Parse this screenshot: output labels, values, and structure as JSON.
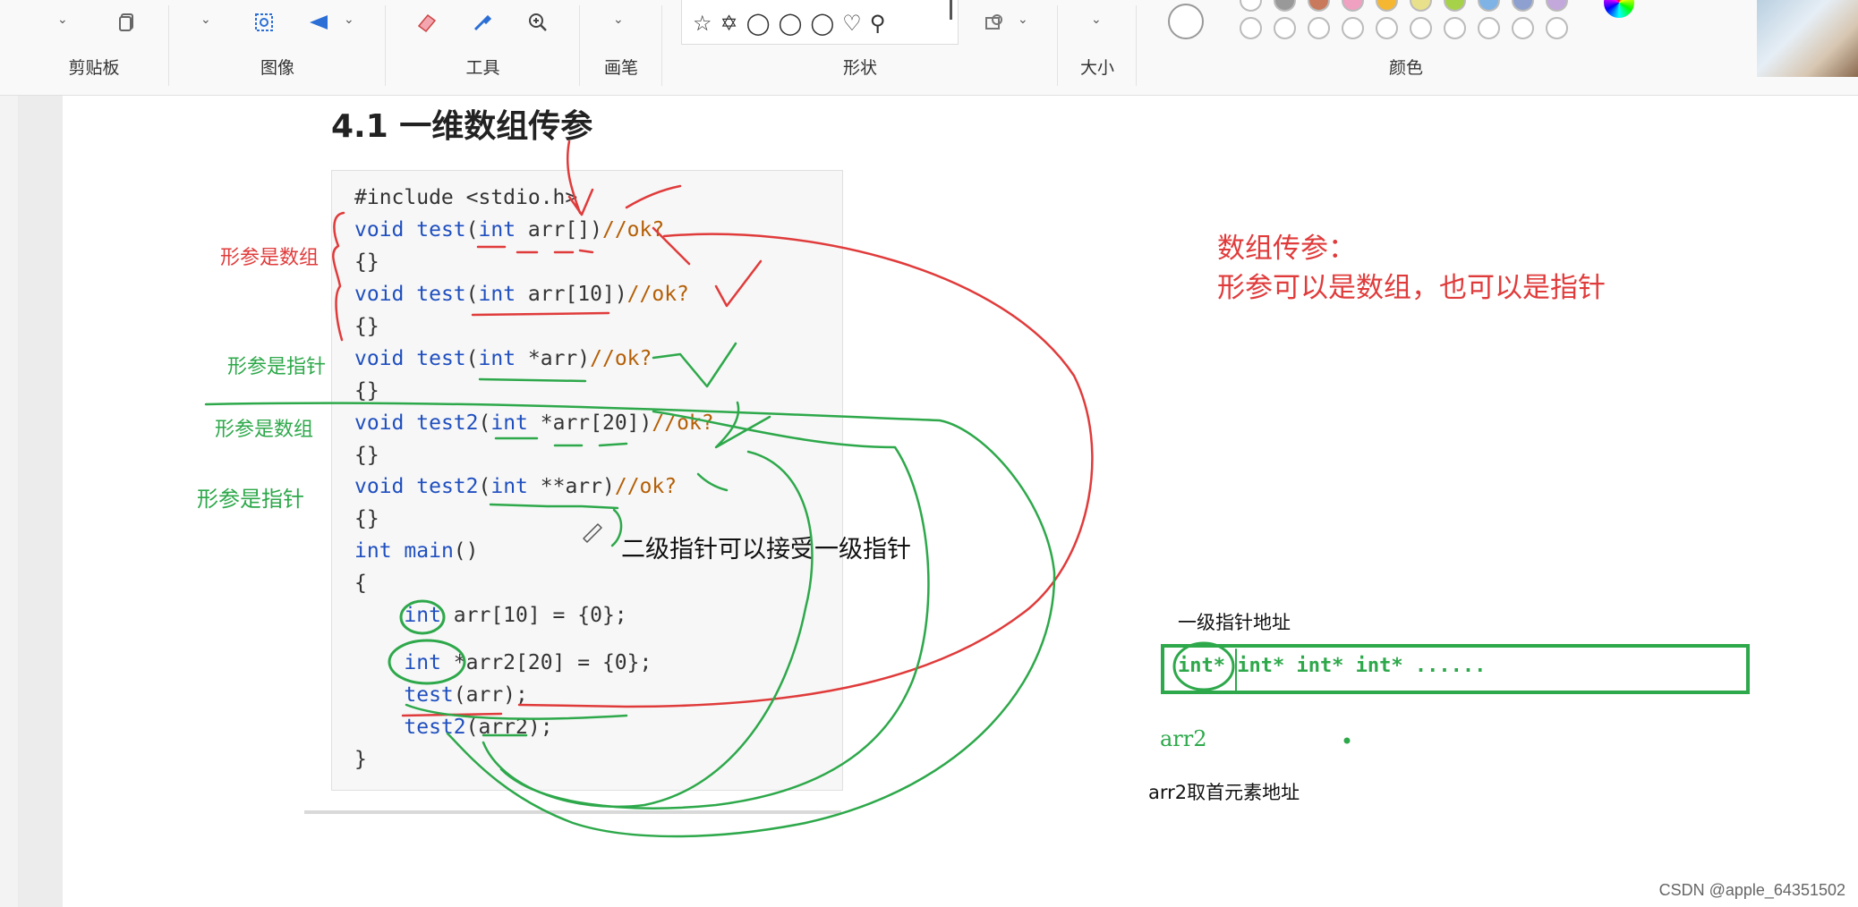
{
  "ribbon": {
    "groups": [
      "剪贴板",
      "图像",
      "工具",
      "画笔",
      "形状",
      "大小",
      "颜色"
    ]
  },
  "slide": {
    "title": "4.1 一维数组传参",
    "code_lines": [
      "#include <stdio.h>",
      "void test(int arr[])//ok?",
      "{}",
      "void test(int arr[10])//ok?",
      "{}",
      "void test(int *arr)//ok?",
      "{}",
      "void test2(int *arr[20])//ok?",
      "{}",
      "void test2(int **arr)//ok?",
      "{}",
      "int main()",
      "{",
      "    int arr[10] = {0};",
      "    int *arr2[20] = {0};",
      "    test(arr);",
      "    test2(arr2);",
      "}"
    ]
  },
  "annotations": {
    "red_param_array": "形参是数组",
    "green_param_pointer_1": "形参是指针",
    "green_param_array": "形参是数组",
    "green_param_pointer_2": "形参是指针",
    "note_double_pointer": "二级指针可以接受一级指针",
    "heading_line1": "数组传参：",
    "heading_line2": "形参可以是数组，也可以是指针",
    "first_level_addr": "一级指针地址",
    "array_cells": "int* int* int* int* ......",
    "arr2_label": "arr2",
    "arr2_first_addr": "arr2取首元素地址"
  },
  "watermark": "CSDN @apple_64351502",
  "colors": {
    "red_ink": "#e03b3b",
    "green_ink": "#2da84a",
    "keyword_blue": "#1f4fbf",
    "comment_orange": "#b45f06"
  },
  "icons": [
    "copy-icon",
    "image-select-icon",
    "rotate-icon",
    "eraser-icon",
    "color-picker-icon",
    "zoom-icon",
    "shape-icons",
    "fill-icon"
  ]
}
